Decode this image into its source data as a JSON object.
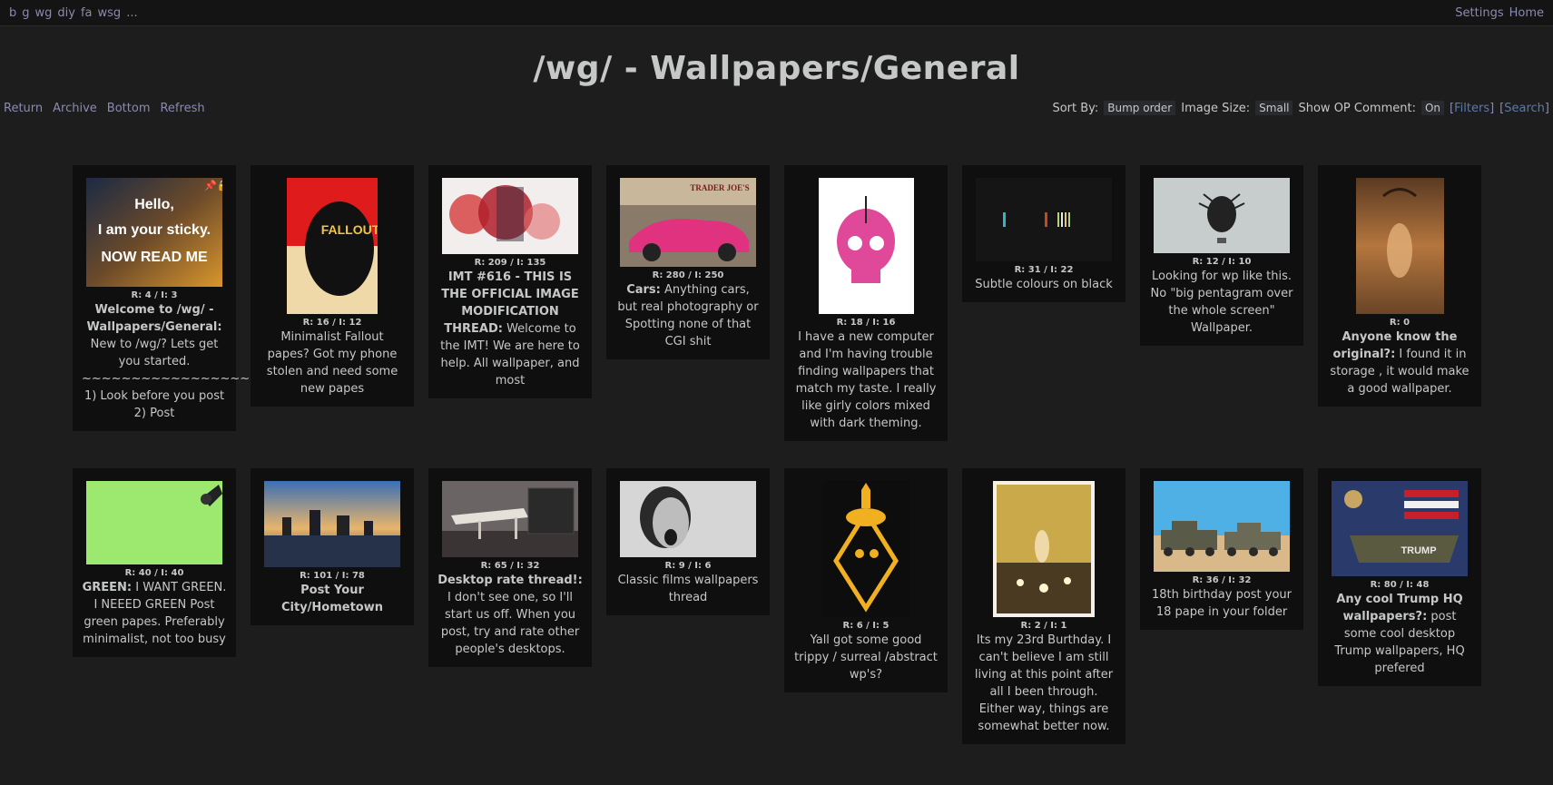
{
  "topbar": {
    "boards": [
      "b",
      "g",
      "wg",
      "diy",
      "fa",
      "wsg",
      "..."
    ],
    "settings": "Settings",
    "home": "Home"
  },
  "title": "/wg/ - Wallpapers/General",
  "nav": {
    "return": "Return",
    "archive": "Archive",
    "bottom": "Bottom",
    "refresh": "Refresh"
  },
  "controls": {
    "sort_label": "Sort By:",
    "sort_value": "Bump order",
    "size_label": "Image Size:",
    "size_value": "Small",
    "op_label": "Show OP Comment:",
    "op_value": "On",
    "filters": "Filters",
    "search": "Search"
  },
  "threads": [
    {
      "meta": "R: 4 / I: 3",
      "subject": "Welcome to /wg/ - Wallpapers/General:",
      "text": " New to /wg/? Lets get you started. ~~~~~~~~~~~~~~~~~~~~ 1) Look before you post 2) Post",
      "thumb_lines": [
        "Hello,",
        "I am your sticky.",
        "NOW READ ME"
      ]
    },
    {
      "meta": "R: 16 / I: 12",
      "subject": "",
      "text": "Minimalist Fallout papes? Got my phone stolen and need some new papes",
      "thumb_lines": [
        "FALLOUT"
      ]
    },
    {
      "meta": "R: 209 / I: 135",
      "subject": "IMT #616 - THIS IS THE OFFICIAL IMAGE MODIFICATION THREAD:",
      "text": " Welcome to the IMT! We are here to help. All wallpaper, and most",
      "thumb_lines": []
    },
    {
      "meta": "R: 280 / I: 250",
      "subject": "Cars:",
      "text": " Anything cars, but real photography or Spotting none of that CGI shit",
      "thumb_lines": [
        "TRADER JOE'S"
      ]
    },
    {
      "meta": "R: 18 / I: 16",
      "subject": "",
      "text": "I have a new computer and I'm having trouble finding wallpapers that match my taste. I really like girly colors mixed with dark theming.",
      "thumb_lines": []
    },
    {
      "meta": "R: 31 / I: 22",
      "subject": "",
      "text": "Subtle colours on black",
      "thumb_lines": []
    },
    {
      "meta": "R: 12 / I: 10",
      "subject": "",
      "text": "Looking for wp like this. No \"big pentagram over the whole screen\" Wallpaper.",
      "thumb_lines": []
    },
    {
      "meta": "R: 0",
      "subject": "Anyone know the original?:",
      "text": " I found it in storage , it would make a good wallpaper.",
      "thumb_lines": []
    },
    {
      "meta": "R: 40 / I: 40",
      "subject": "GREEN:",
      "text": " I WANT GREEN. I NEEED GREEN Post green papes. Preferably minimalist, not too busy",
      "thumb_lines": []
    },
    {
      "meta": "R: 101 / I: 78",
      "subject": "Post Your City/Hometown",
      "text": "",
      "thumb_lines": []
    },
    {
      "meta": "R: 65 / I: 32",
      "subject": "Desktop rate thread!:",
      "text": " I don't see one, so I'll start us off. When you post, try and rate other people's desktops.",
      "thumb_lines": []
    },
    {
      "meta": "R: 9 / I: 6",
      "subject": "",
      "text": "Classic films wallpapers thread",
      "thumb_lines": []
    },
    {
      "meta": "R: 6 / I: 5",
      "subject": "",
      "text": "Yall got some good trippy / surreal /abstract wp's?",
      "thumb_lines": []
    },
    {
      "meta": "R: 2 / I: 1",
      "subject": "",
      "text": "Its my 23rd Burthday. I can't believe I am still living at this point after all I been through. Either way, things are somewhat better now.",
      "thumb_lines": []
    },
    {
      "meta": "R: 36 / I: 32",
      "subject": "",
      "text": "18th birthday post your 18 pape in your folder",
      "thumb_lines": []
    },
    {
      "meta": "R: 80 / I: 48",
      "subject": "Any cool Trump HQ wallpapers?:",
      "text": " post some cool desktop Trump wallpapers, HQ prefered",
      "thumb_lines": [
        "TRUMP"
      ]
    }
  ]
}
